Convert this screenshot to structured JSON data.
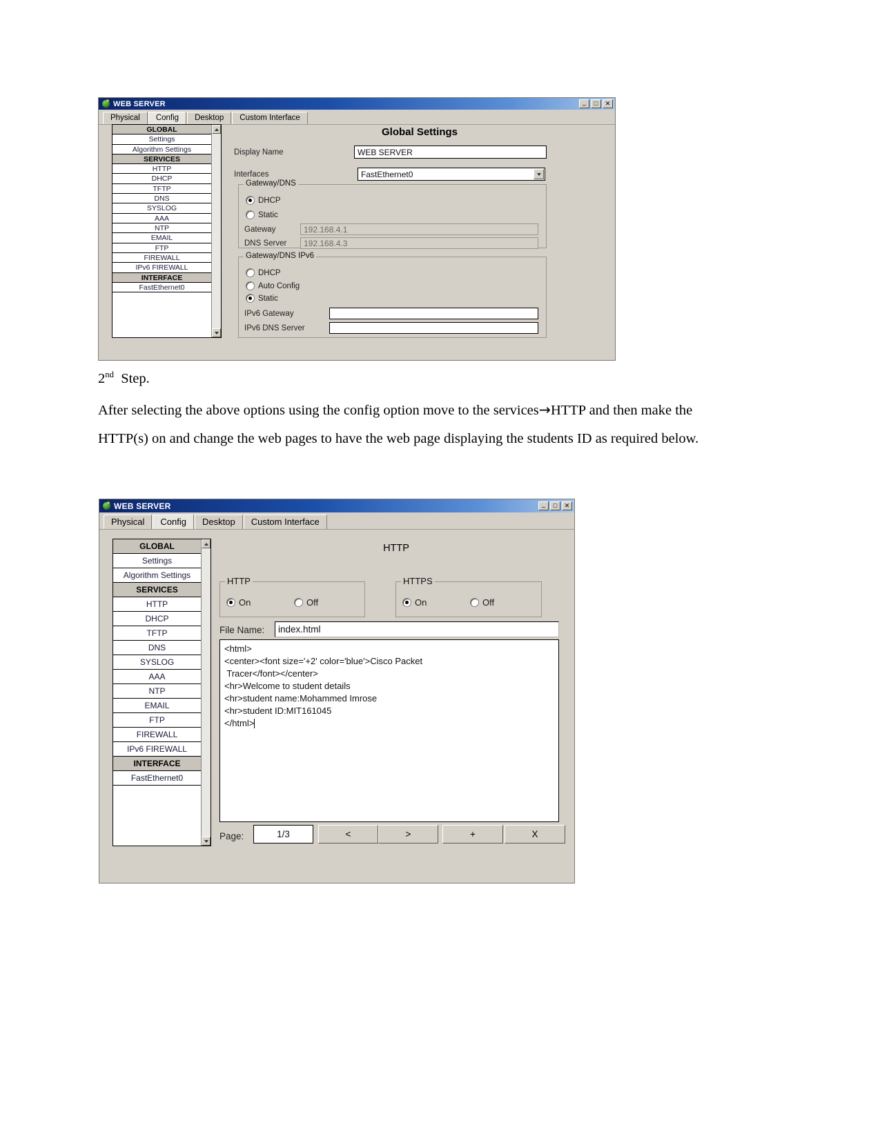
{
  "document": {
    "step_heading_number": "2",
    "step_heading_ordinal": "nd",
    "step_heading_text": "Step.",
    "paragraph_part1": "After selecting the above options using the config option move to the services",
    "paragraph_arrow": "→",
    "paragraph_part2": "HTTP and then make the HTTP(s) on and change the web pages to have the web page displaying the students ID as required below."
  },
  "window1": {
    "title": "WEB SERVER",
    "window_buttons": {
      "minimize": "_",
      "maximize": "□",
      "close": "✕"
    },
    "tabs": [
      {
        "label": "Physical",
        "active": false
      },
      {
        "label": "Config",
        "active": true
      },
      {
        "label": "Desktop",
        "active": false
      },
      {
        "label": "Custom Interface",
        "active": false
      }
    ],
    "sidebar": [
      {
        "label": "GLOBAL",
        "type": "header"
      },
      {
        "label": "Settings",
        "type": "item"
      },
      {
        "label": "Algorithm Settings",
        "type": "item"
      },
      {
        "label": "SERVICES",
        "type": "header"
      },
      {
        "label": "HTTP",
        "type": "item"
      },
      {
        "label": "DHCP",
        "type": "item"
      },
      {
        "label": "TFTP",
        "type": "item"
      },
      {
        "label": "DNS",
        "type": "item"
      },
      {
        "label": "SYSLOG",
        "type": "item"
      },
      {
        "label": "AAA",
        "type": "item"
      },
      {
        "label": "NTP",
        "type": "item"
      },
      {
        "label": "EMAIL",
        "type": "item"
      },
      {
        "label": "FTP",
        "type": "item"
      },
      {
        "label": "FIREWALL",
        "type": "item"
      },
      {
        "label": "IPv6 FIREWALL",
        "type": "item"
      },
      {
        "label": "INTERFACE",
        "type": "header"
      },
      {
        "label": "FastEthernet0",
        "type": "item"
      }
    ],
    "panel_title": "Global Settings",
    "display_name_label": "Display Name",
    "display_name_value": "WEB SERVER",
    "interfaces_label": "Interfaces",
    "interfaces_value": "FastEthernet0",
    "gateway_dns": {
      "legend": "Gateway/DNS",
      "dhcp_label": "DHCP",
      "dhcp_checked": true,
      "static_label": "Static",
      "static_checked": false,
      "gateway_label": "Gateway",
      "gateway_value": "192.168.4.1",
      "dns_label": "DNS Server",
      "dns_value": "192.168.4.3"
    },
    "gateway_dns_ipv6": {
      "legend": "Gateway/DNS IPv6",
      "dhcp_label": "DHCP",
      "dhcp_checked": false,
      "auto_label": "Auto Config",
      "auto_checked": false,
      "static_label": "Static",
      "static_checked": true,
      "gateway_label": "IPv6 Gateway",
      "gateway_value": "",
      "dns_label": "IPv6 DNS Server",
      "dns_value": ""
    }
  },
  "window2": {
    "title": "WEB SERVER",
    "window_buttons": {
      "minimize": "_",
      "maximize": "□",
      "close": "✕"
    },
    "tabs": [
      {
        "label": "Physical",
        "active": false
      },
      {
        "label": "Config",
        "active": true
      },
      {
        "label": "Desktop",
        "active": false
      },
      {
        "label": "Custom Interface",
        "active": false
      }
    ],
    "sidebar": [
      {
        "label": "GLOBAL",
        "type": "header"
      },
      {
        "label": "Settings",
        "type": "item"
      },
      {
        "label": "Algorithm Settings",
        "type": "item"
      },
      {
        "label": "SERVICES",
        "type": "header"
      },
      {
        "label": "HTTP",
        "type": "item"
      },
      {
        "label": "DHCP",
        "type": "item"
      },
      {
        "label": "TFTP",
        "type": "item"
      },
      {
        "label": "DNS",
        "type": "item"
      },
      {
        "label": "SYSLOG",
        "type": "item"
      },
      {
        "label": "AAA",
        "type": "item"
      },
      {
        "label": "NTP",
        "type": "item"
      },
      {
        "label": "EMAIL",
        "type": "item"
      },
      {
        "label": "FTP",
        "type": "item"
      },
      {
        "label": "FIREWALL",
        "type": "item"
      },
      {
        "label": "IPv6 FIREWALL",
        "type": "item"
      },
      {
        "label": "INTERFACE",
        "type": "header"
      },
      {
        "label": "FastEthernet0",
        "type": "item"
      }
    ],
    "panel_title": "HTTP",
    "http_group": {
      "legend": "HTTP",
      "on_label": "On",
      "off_label": "Off",
      "on_checked": true,
      "off_checked": false
    },
    "https_group": {
      "legend": "HTTPS",
      "on_label": "On",
      "off_label": "Off",
      "on_checked": true,
      "off_checked": false
    },
    "file_name_label": "File Name:",
    "file_name_value": "index.html",
    "code": "<html>\n<center><font size='+2' color='blue'>Cisco Packet\n Tracer</font></center>\n<hr>Welcome to student details\n<hr>student name:Mohammed Imrose\n<hr>student ID:MIT161045\n</html>",
    "page_label": "Page:",
    "page_value": "1/3",
    "buttons": {
      "prev": "<",
      "next": ">",
      "add": "+",
      "delete": "X"
    }
  }
}
